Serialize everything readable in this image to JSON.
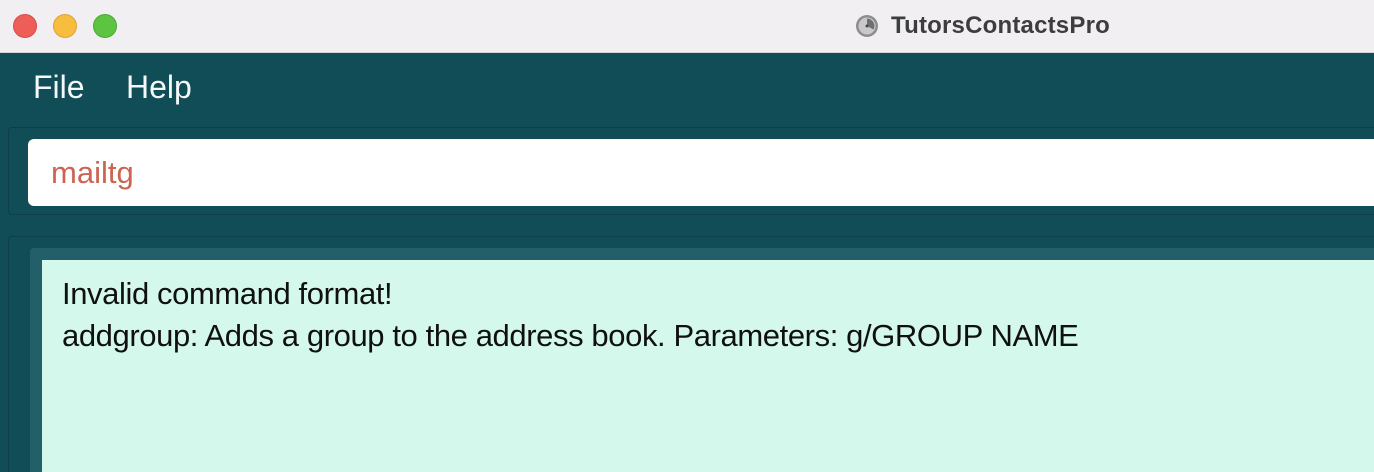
{
  "window": {
    "title": "TutorsContactsPro",
    "icon": "clock-app-icon",
    "controls": [
      "close",
      "minimize",
      "maximize"
    ]
  },
  "menu": {
    "file_label": "File",
    "help_label": "Help"
  },
  "command_box": {
    "value": "mailtg",
    "text_color": "#cd6452"
  },
  "result_display": {
    "lines": [
      "Invalid command format!",
      "addgroup: Adds a group to the address book. Parameters: g/GROUP NAME"
    ],
    "background": "#d4f8ec"
  },
  "colors": {
    "app_background": "#114d57",
    "titlebar": "#f1eff2"
  }
}
